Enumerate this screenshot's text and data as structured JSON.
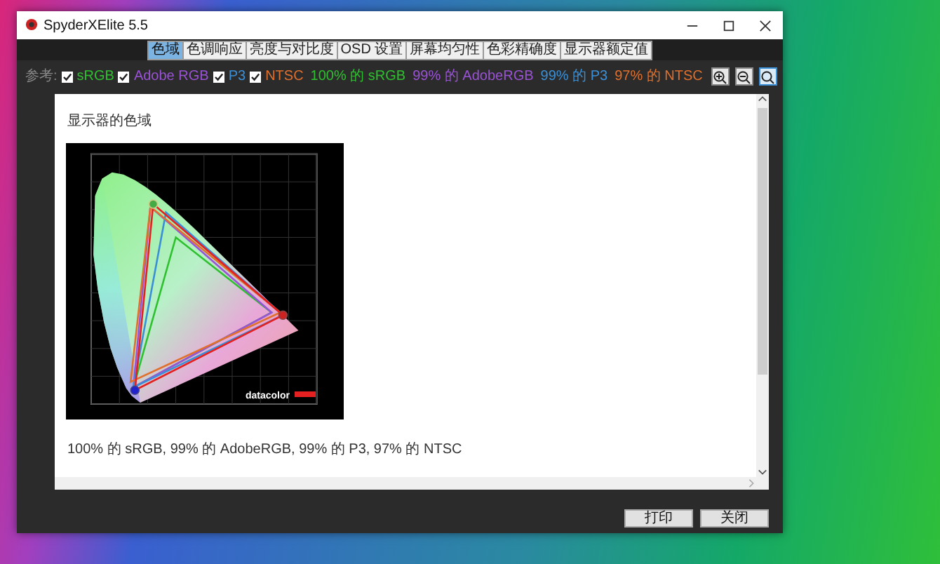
{
  "window": {
    "title": "SpyderXElite 5.5"
  },
  "tabs": [
    {
      "label": "色域",
      "selected": true
    },
    {
      "label": "色调响应",
      "selected": false
    },
    {
      "label": "亮度与对比度",
      "selected": false
    },
    {
      "label": "OSD 设置",
      "selected": false
    },
    {
      "label": "屏幕均匀性",
      "selected": false
    },
    {
      "label": "色彩精确度",
      "selected": false
    },
    {
      "label": "显示器额定值",
      "selected": false
    }
  ],
  "reference": {
    "label": "参考:",
    "options": [
      {
        "label": "sRGB",
        "checked": true,
        "color": "#2fc02f"
      },
      {
        "label": "Adobe RGB",
        "checked": true,
        "color": "#9a52d6"
      },
      {
        "label": "P3",
        "checked": true,
        "color": "#3b8fd6"
      },
      {
        "label": "NTSC",
        "checked": true,
        "color": "#e0702c"
      }
    ]
  },
  "results": [
    {
      "text": "100% 的 sRGB",
      "color": "#2fc02f"
    },
    {
      "text": "99% 的 AdobeRGB",
      "color": "#9a52d6"
    },
    {
      "text": "99% 的 P3",
      "color": "#3b8fd6"
    },
    {
      "text": "97% 的 NTSC",
      "color": "#e0702c"
    }
  ],
  "zoom_tools": [
    {
      "kind": "zoom-in",
      "selected": false
    },
    {
      "kind": "zoom-out",
      "selected": false
    },
    {
      "kind": "zoom-fit",
      "selected": true
    }
  ],
  "content": {
    "heading": "显示器的色域",
    "chart": {
      "logo": "datacolor"
    },
    "summary": "100% 的 sRGB, 99% 的 AdobeRGB, 99% 的 P3, 97% 的 NTSC"
  },
  "buttons": [
    "打印",
    "关闭"
  ]
}
